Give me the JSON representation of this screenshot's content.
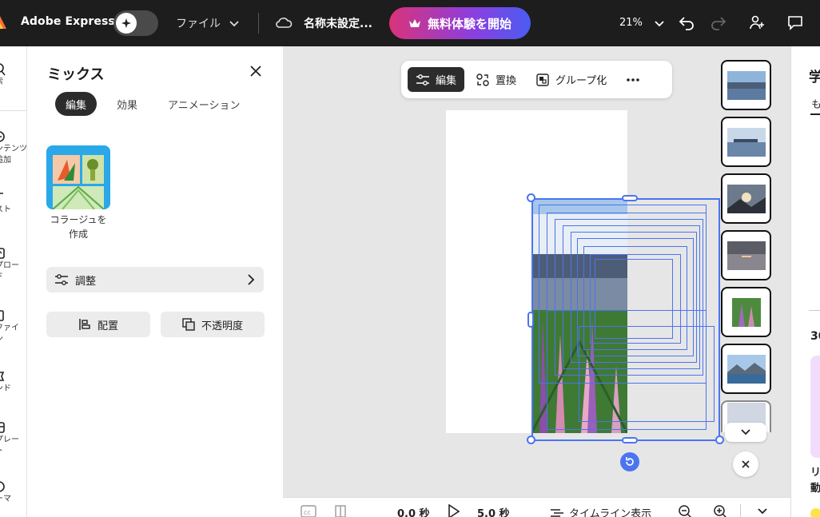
{
  "topbar": {
    "brand": "Adobe Express",
    "file_menu": "ファイル",
    "doc_title": "名称未設定...",
    "trial_button": "無料体験を開始",
    "zoom": "21%"
  },
  "rail": {
    "items": [
      {
        "label": "索",
        "icon": "search-icon"
      },
      {
        "label": "ンテンツ\n追加",
        "icon": "plus-icon"
      },
      {
        "label": "スト",
        "icon": "text-icon"
      },
      {
        "label": "プロー\nド",
        "icon": "upload-icon"
      },
      {
        "label": "ファイ\nン",
        "icon": "file-icon"
      },
      {
        "label": "ンド",
        "icon": "brand-icon"
      },
      {
        "label": "プレー\nト",
        "icon": "template-icon"
      },
      {
        "label": "ーマ",
        "icon": "theme-icon"
      }
    ]
  },
  "panel": {
    "title": "ミックス",
    "tabs": [
      "編集",
      "効果",
      "アニメーション"
    ],
    "active_tab": "編集",
    "collage_label": "コラージュを\n作成",
    "adjust_label": "調整",
    "arrange_label": "配置",
    "opacity_label": "不透明度"
  },
  "float_toolbar": {
    "edit": "編集",
    "replace": "置換",
    "group": "グループ化"
  },
  "bottombar": {
    "time_start": "0.0 秒",
    "time_end": "5.0 秒",
    "timeline": "タイムライン表示"
  },
  "right_panel": {
    "title": "学",
    "tab": "も",
    "number": "30",
    "text": "リ\n動"
  },
  "thumbnails": [
    "city-waterfront",
    "harbor-boats",
    "sunset-mountain",
    "lake-dusk",
    "lupine-flowers",
    "alpine-lake",
    "partial"
  ],
  "colors": {
    "selection": "#4a74f0",
    "trial_gradient_start": "#d9337a",
    "trial_gradient_end": "#4b5cf2",
    "topbar_bg": "#1d1d1d"
  }
}
